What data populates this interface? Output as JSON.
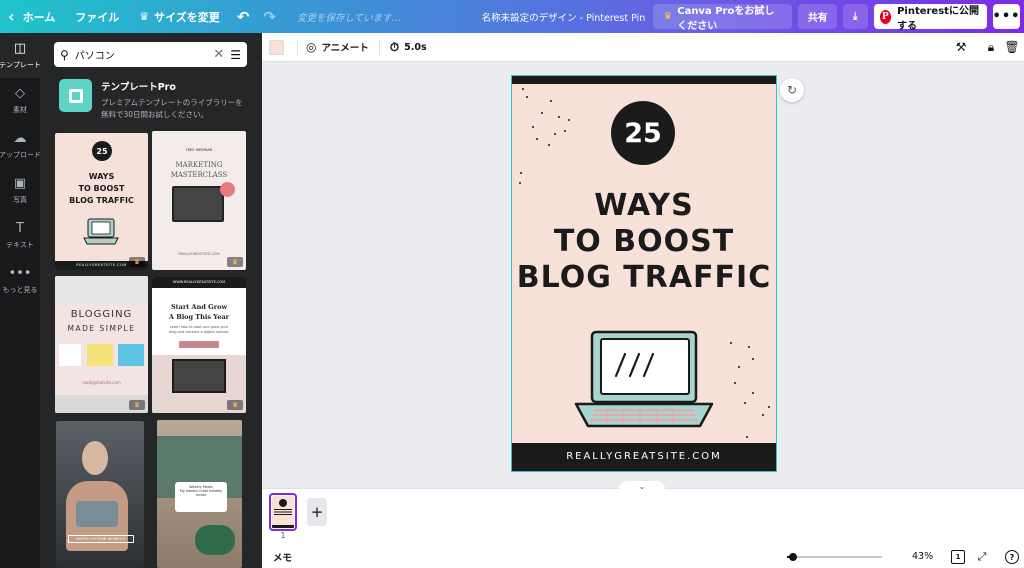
{
  "topbar": {
    "home": "ホーム",
    "file": "ファイル",
    "resize": "サイズを変更",
    "saving_status": "変更を保存しています…",
    "doc_title": "名称未設定のデザイン - Pinterest Pin",
    "canva_pro": "Canva Proをお試しください",
    "share": "共有",
    "publish": "Pinterestに公開する",
    "more": "•••"
  },
  "rail": {
    "items": [
      {
        "label": "テンプレート",
        "icon": "template-icon",
        "glyph": "◫"
      },
      {
        "label": "素材",
        "icon": "elements-icon",
        "glyph": "◇"
      },
      {
        "label": "アップロード",
        "icon": "upload-icon",
        "glyph": "☁"
      },
      {
        "label": "写真",
        "icon": "photo-icon",
        "glyph": "▣"
      },
      {
        "label": "テキスト",
        "icon": "text-icon",
        "glyph": "T"
      },
      {
        "label": "もっと見る",
        "icon": "more-icon",
        "glyph": "•••"
      }
    ]
  },
  "panel": {
    "search_value": "パソコン",
    "promo_title": "テンプレートPro",
    "promo_desc_1": "プレミアムテンプレートのライブラリーを",
    "promo_desc_2": "無料で30日間お試しください。",
    "templates": {
      "t1": {
        "number": "25",
        "line1": "WAYS",
        "line2": "TO BOOST",
        "line3": "BLOG TRAFFIC",
        "footer": "REALLYGREATSITE.COM"
      },
      "t2": {
        "subtitle": "FREE WEBINAR",
        "title1": "MARKETING",
        "title2": "MASTERCLASS",
        "footer": "REALLYGREATSITE.COM"
      },
      "t3": {
        "title1": "BLOGGING",
        "title2": "MADE SIMPLE",
        "footer": "reallygreatsite.com"
      },
      "t4": {
        "bar": "WWW.REALLYGREATSITE.COM",
        "title1": "Start And Grow",
        "title2": "A Blog This Year",
        "desc": "Learn how to start and grow your blog and become a digital nomad."
      },
      "t5": {
        "tag": "SWITCH UP YOUR WORKOUT"
      },
      "t6": {
        "card_title": "Weekly Meals",
        "card_text": "My weekly meal healthy recipe"
      }
    }
  },
  "toolbar": {
    "swatch_color": "#f8e1d9",
    "animate": "アニメート",
    "duration": "5.0s"
  },
  "design": {
    "number": "25",
    "line1": "WAYS",
    "line2": "TO BOOST",
    "line3": "BLOG TRAFFIC",
    "footer": "REALLYGREATSITE.COM",
    "background_color": "#f8e1d9",
    "laptop_color": "#a8d5cf",
    "keyboard_color": "#e8a7ad"
  },
  "pages": {
    "current": "1"
  },
  "bottombar": {
    "notes": "メモ",
    "zoom_value": 43,
    "zoom_label": "43%",
    "page_count": "1",
    "help": "?"
  }
}
